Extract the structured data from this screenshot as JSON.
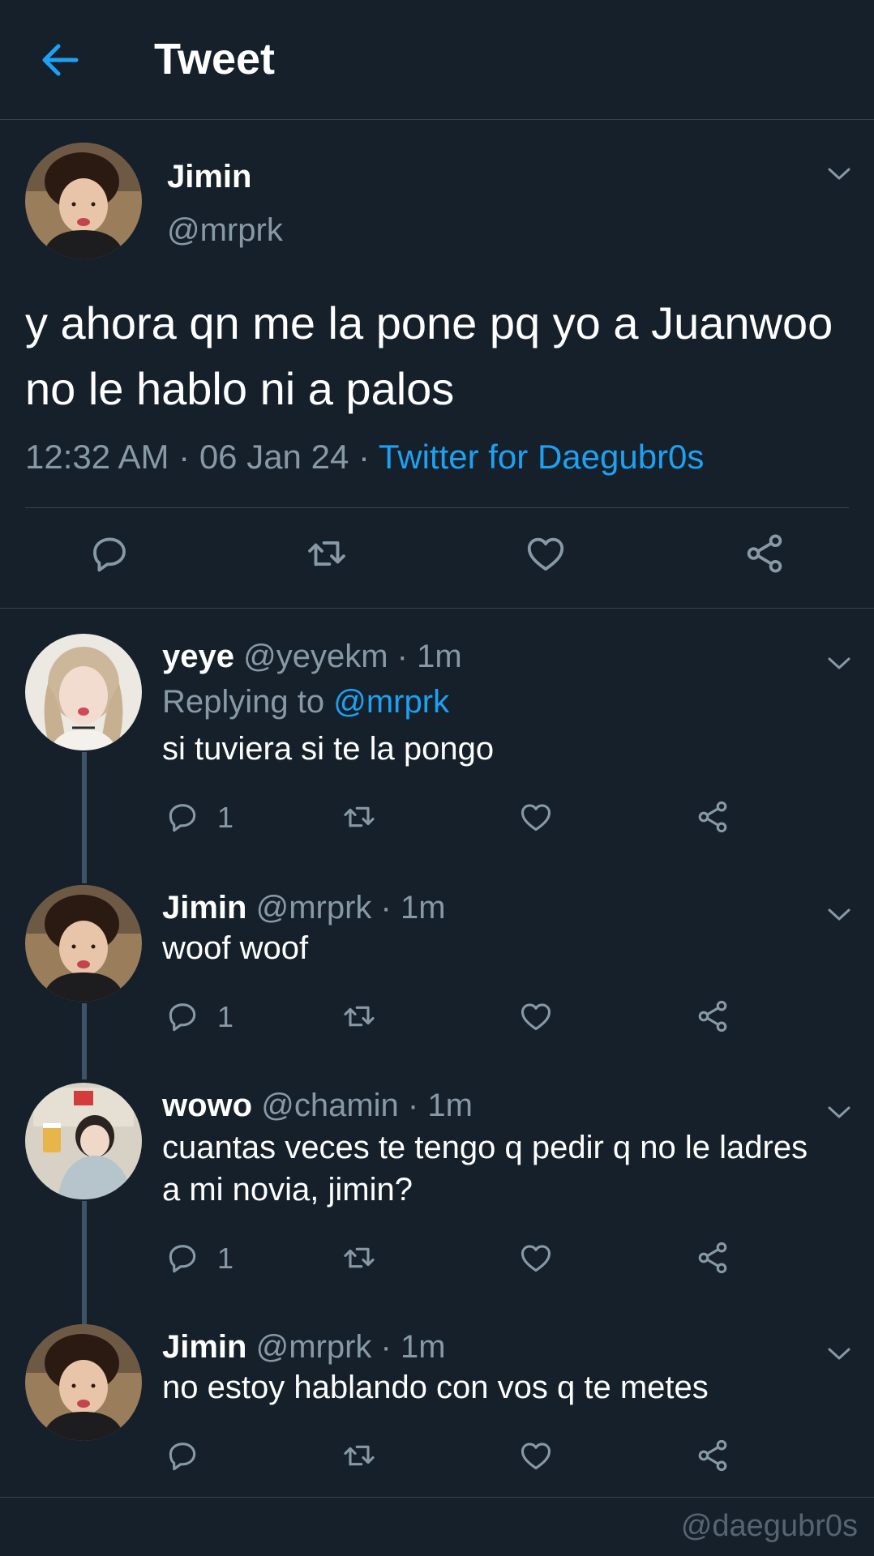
{
  "header": {
    "title": "Tweet"
  },
  "tweet": {
    "name": "Jimin",
    "handle": "@mrprk",
    "text": "y ahora qn me la pone pq yo a Juanwoo no le hablo ni a palos",
    "time": "12:32 AM",
    "date": "06 Jan 24",
    "source": "Twitter for Daegubr0s"
  },
  "replies": [
    {
      "name": "yeye",
      "handle": "@yeyekm",
      "time": "1m",
      "replying_label": "Replying to",
      "replying_to": "@mrprk",
      "text": "si tuviera si te la pongo",
      "reply_count": "1"
    },
    {
      "name": "Jimin",
      "handle": "@mrprk",
      "time": "1m",
      "text": "woof woof",
      "reply_count": "1"
    },
    {
      "name": "wowo",
      "handle": "@chamin",
      "time": "1m",
      "text_line1": "cuantas veces te tengo q pedir q no le ladres",
      "text_line2": "a mi novia, jimin?",
      "reply_count": "1"
    },
    {
      "name": "Jimin",
      "handle": "@mrprk",
      "time": "1m",
      "text": "no estoy hablando con vos q te metes"
    }
  ],
  "separators": {
    "dot": "·"
  },
  "watermark": "@daegubr0s",
  "colors": {
    "background": "#15202b",
    "accent": "#1da1f2",
    "muted": "#8899a6",
    "divider": "#38444d"
  }
}
